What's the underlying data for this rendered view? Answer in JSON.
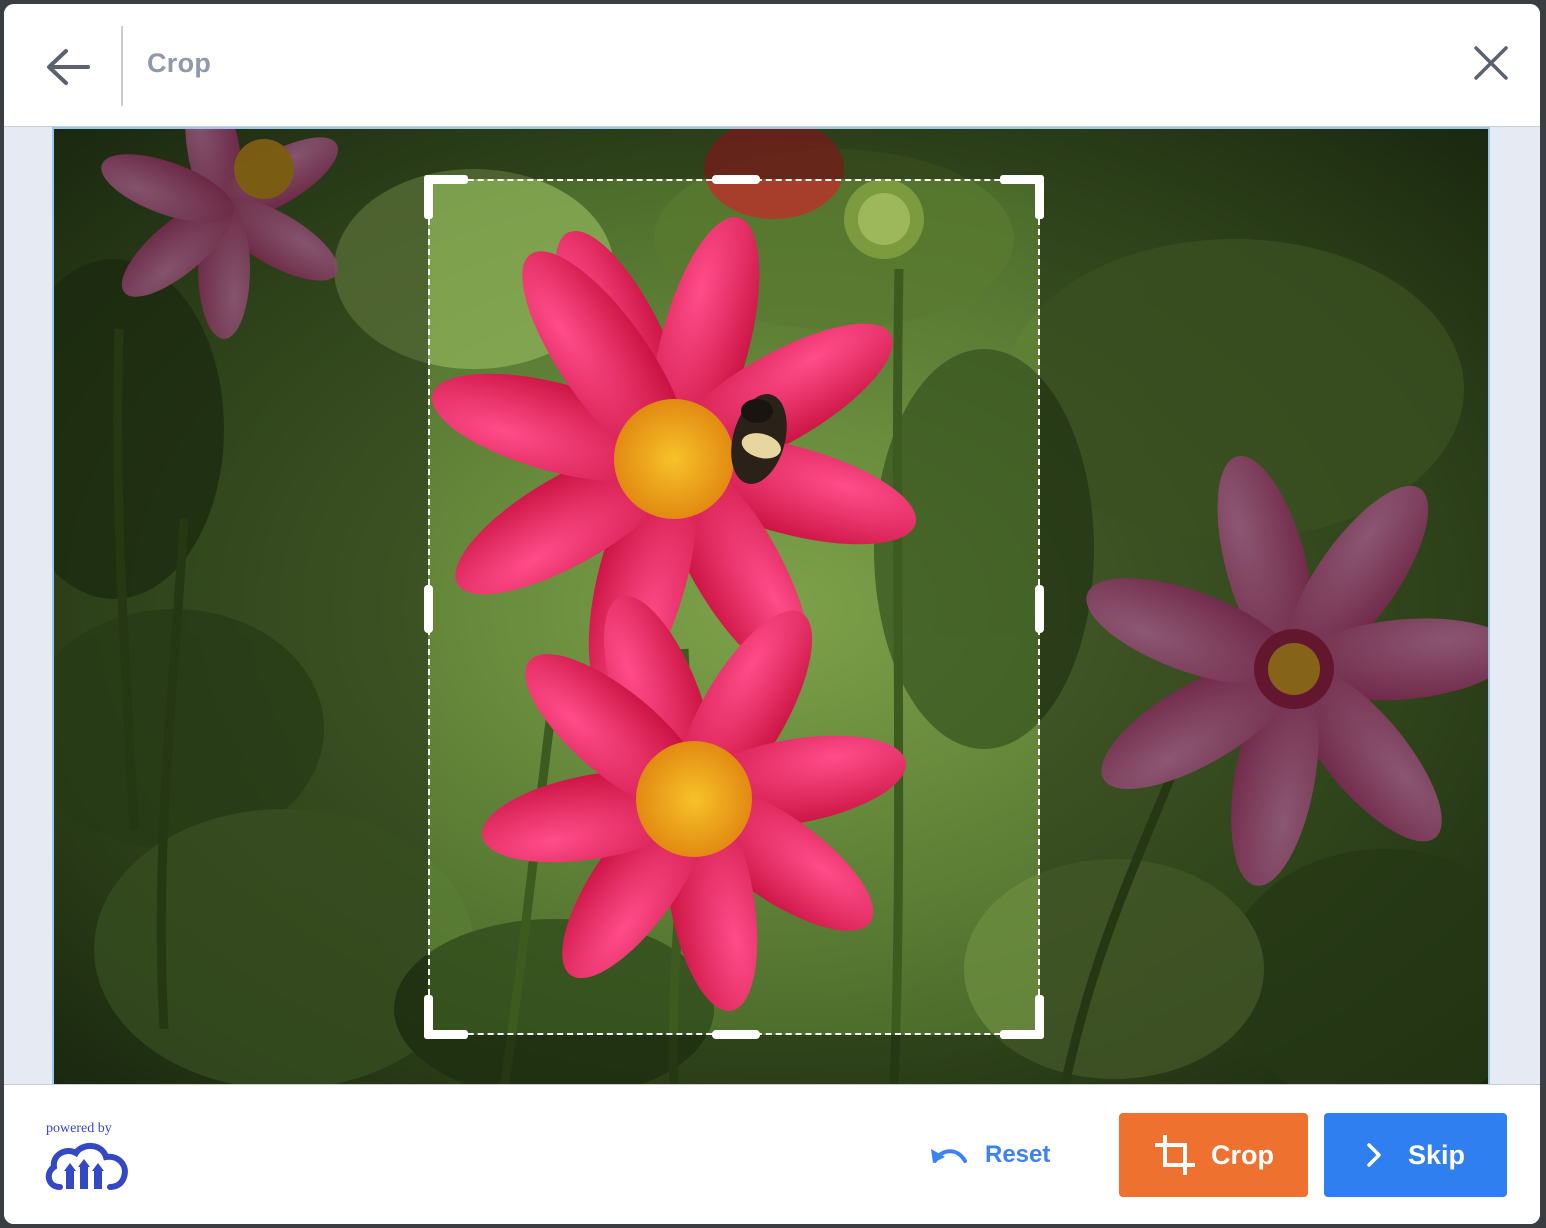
{
  "header": {
    "title": "Crop"
  },
  "footer": {
    "powered_by": "powered by",
    "reset_label": "Reset",
    "crop_label": "Crop",
    "skip_label": "Skip"
  },
  "colors": {
    "crop_button": "#ee712f",
    "skip_button": "#2f7ff0",
    "link": "#3b82f6",
    "brand": "#3448c5",
    "title": "#8e9aab"
  },
  "icons": {
    "back": "arrow-left-icon",
    "close": "close-icon",
    "reset": "undo-icon",
    "crop": "crop-icon",
    "skip": "chevron-right-icon",
    "logo": "cloudinary-logo"
  }
}
